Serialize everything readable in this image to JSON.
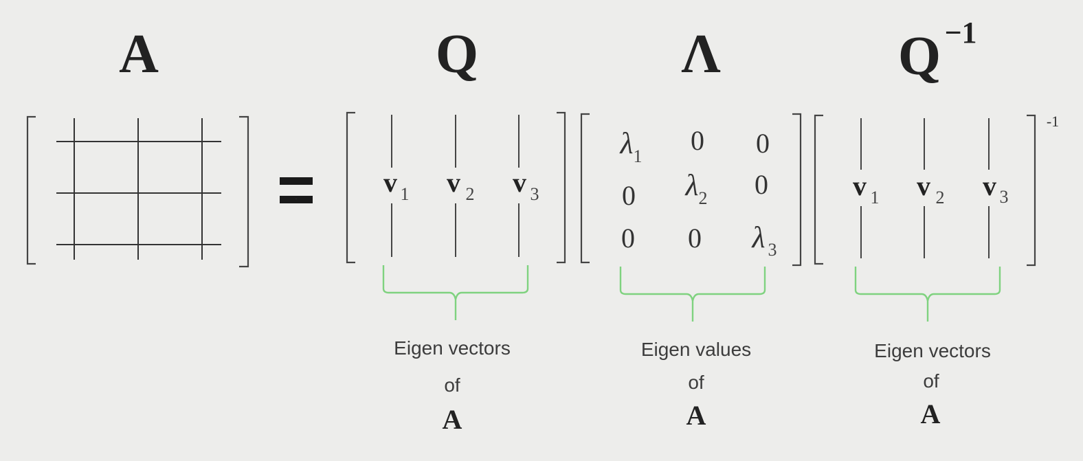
{
  "colors": {
    "background": "#ededeb",
    "brace": "#7fd27f",
    "ink": "#333333"
  },
  "headers": {
    "A": "A",
    "Q": "Q",
    "Lambda": "Λ",
    "Qinv_base": "Q",
    "Qinv_exp": "−1"
  },
  "equals": "=",
  "inverse_superscript": "-1",
  "Q_matrix": {
    "v": [
      "v",
      "v",
      "v"
    ],
    "subs": [
      "1",
      "2",
      "3"
    ]
  },
  "Qinv_matrix": {
    "v": [
      "v",
      "v",
      "v"
    ],
    "subs": [
      "1",
      "2",
      "3"
    ]
  },
  "Lambda_matrix": {
    "lambda": "λ",
    "zero": "0",
    "lambda_subs": [
      "1",
      "2",
      "3"
    ]
  },
  "captions": {
    "Q": {
      "line1": "Eigen vectors",
      "line2": "of",
      "line3": "A"
    },
    "Lambda": {
      "line1": "Eigen values",
      "line2": "of",
      "line3": "A"
    },
    "Qinv": {
      "line1": "Eigen vectors",
      "line2": "of",
      "line3": "A"
    }
  }
}
